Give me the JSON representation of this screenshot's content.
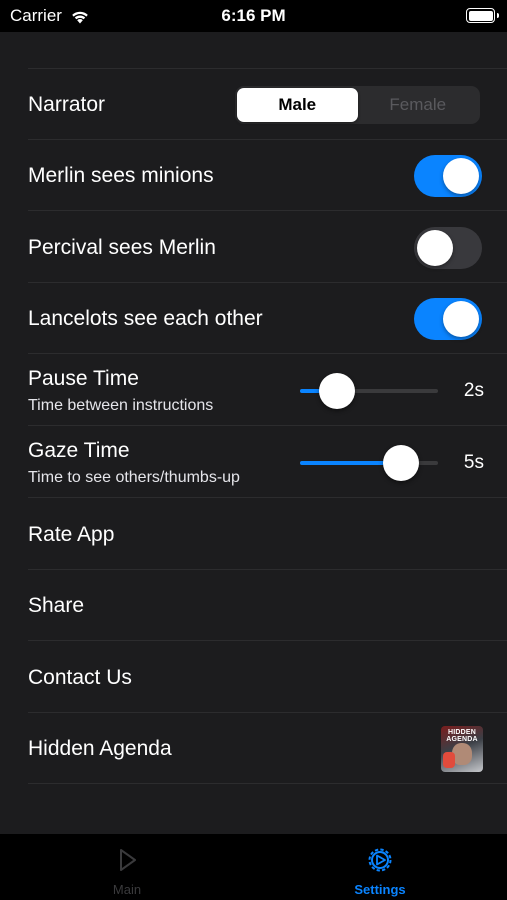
{
  "status_bar": {
    "carrier": "Carrier",
    "time": "6:16 PM",
    "battery_level": 1.0
  },
  "settings": {
    "narrator": {
      "label": "Narrator",
      "options": [
        "Male",
        "Female"
      ],
      "selected": "Male"
    },
    "toggles": [
      {
        "label": "Merlin sees minions",
        "on": true
      },
      {
        "label": "Percival sees Merlin",
        "on": false
      },
      {
        "label": "Lancelots see each other",
        "on": true
      }
    ],
    "sliders": [
      {
        "title": "Pause Time",
        "subtitle": "Time between instructions",
        "value_label": "2s",
        "fraction": 0.27
      },
      {
        "title": "Gaze Time",
        "subtitle": "Time to see others/thumbs-up",
        "value_label": "5s",
        "fraction": 0.73
      }
    ],
    "links": [
      {
        "label": "Rate App"
      },
      {
        "label": "Share"
      },
      {
        "label": "Contact Us"
      },
      {
        "label": "Hidden Agenda",
        "icon_text": "HIDDEN AGENDA",
        "icon": "hidden-agenda-app-icon"
      }
    ]
  },
  "tab_bar": {
    "tabs": [
      {
        "label": "Main",
        "icon": "play-icon",
        "selected": false
      },
      {
        "label": "Settings",
        "icon": "gear-icon",
        "selected": true
      }
    ]
  },
  "colors": {
    "accent": "#0a84ff",
    "background": "#1c1c1e",
    "tab_bar": "#000000"
  }
}
